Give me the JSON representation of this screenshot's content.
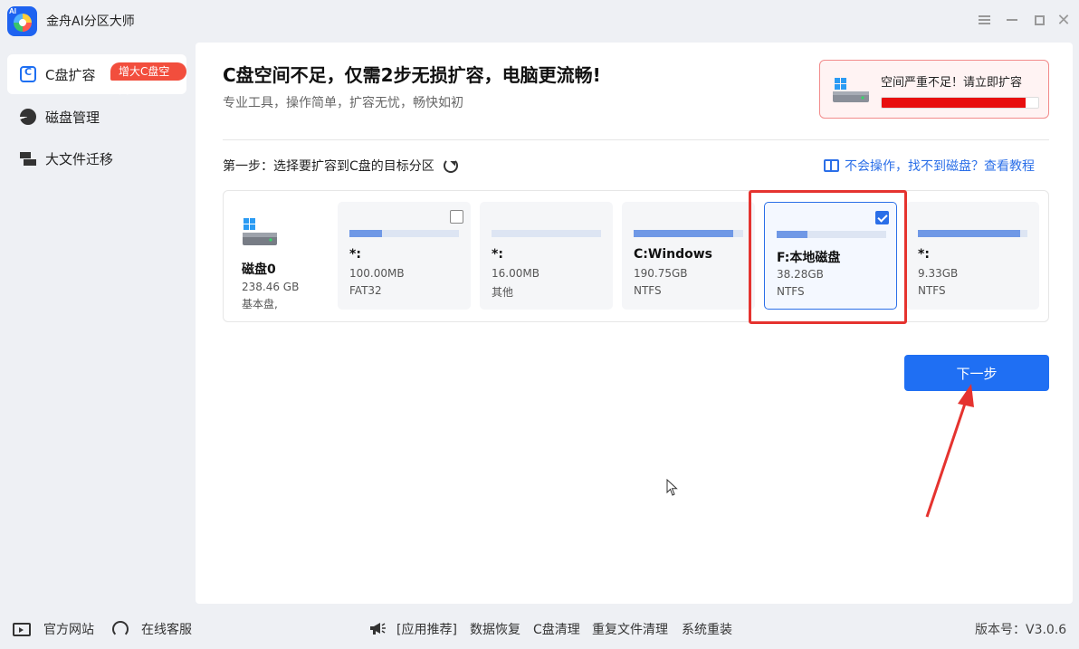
{
  "app": {
    "title": "金舟AI分区大师",
    "logo_text": "AI"
  },
  "sidebar": {
    "items": [
      {
        "label": "C盘扩容",
        "badge": "增大C盘空间",
        "active": true
      },
      {
        "label": "磁盘管理"
      },
      {
        "label": "大文件迁移"
      }
    ]
  },
  "main": {
    "headline": "C盘空间不足，仅需2步无损扩容，电脑更流畅!",
    "subline": "专业工具，操作简单，扩容无忧，畅快如初",
    "warning": {
      "text": "空间严重不足！请立即扩容",
      "usage_fraction": 0.92,
      "color": "#e80e0e"
    },
    "step_label": "第一步：选择要扩容到C盘的目标分区",
    "help_link": "不会操作，找不到磁盘？查看教程",
    "disk": {
      "name": "磁盘0",
      "size": "238.46 GB",
      "type": "基本盘,"
    },
    "partitions": [
      {
        "name": "*:",
        "size": "100.00MB",
        "fs": "FAT32",
        "usage_fraction": 0.3,
        "checkbox": true,
        "selected": false
      },
      {
        "name": "*:",
        "size": "16.00MB",
        "fs": "其他",
        "usage_fraction": 0.0,
        "checkbox": false,
        "selected": false
      },
      {
        "name": "C:Windows",
        "size": "190.75GB",
        "fs": "NTFS",
        "usage_fraction": 0.91,
        "checkbox": false,
        "selected": false
      },
      {
        "name": "F:本地磁盘",
        "size": "38.28GB",
        "fs": "NTFS",
        "usage_fraction": 0.28,
        "checkbox": true,
        "selected": true
      },
      {
        "name": "*:",
        "size": "9.33GB",
        "fs": "NTFS",
        "usage_fraction": 0.93,
        "checkbox": false,
        "selected": false
      }
    ],
    "next_button": "下一步"
  },
  "footer": {
    "site": "官方网站",
    "service": "在线客服",
    "recommend": "[应用推荐]",
    "links": [
      "数据恢复",
      "C盘清理",
      "重复文件清理",
      "系统重装"
    ],
    "version": "版本号：V3.0.6"
  },
  "colors": {
    "accent": "#1f6ff3",
    "highlight": "#e5332f",
    "badge": "#f24e3d"
  }
}
